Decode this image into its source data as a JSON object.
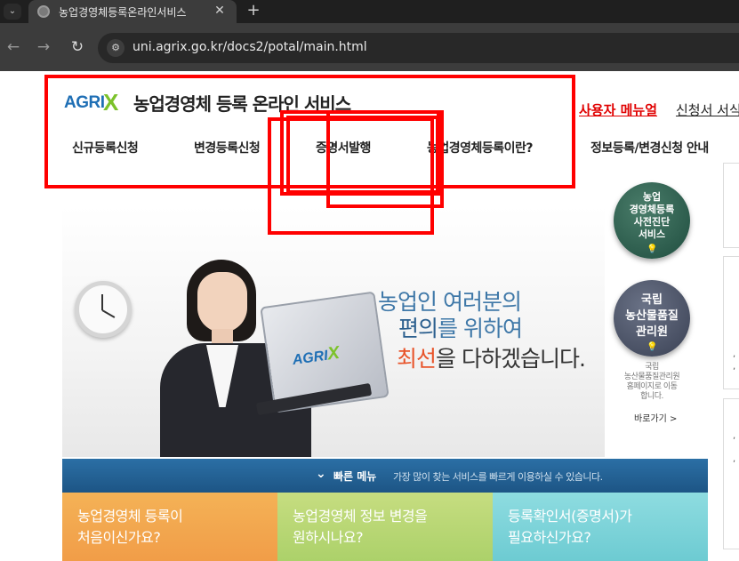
{
  "browser": {
    "tab_title": "농업경영체등록온라인서비스",
    "tab_close": "✕",
    "new_tab": "+",
    "tab_menu": "⌄",
    "back": "←",
    "forward": "→",
    "reload": "↻",
    "site_info": "⚙",
    "url": "uni.agrix.go.kr/docs2/potal/main.html"
  },
  "header": {
    "logo_text": "AGRI",
    "logo_x": "X",
    "title": "농업경영체 등록 온라인 서비스",
    "manual_link": "사용자 메뉴얼",
    "form_link": "신청서 서식"
  },
  "gnb": {
    "items": [
      "신규등록신청",
      "변경등록신청",
      "증명서발행",
      "농업경영체등록이란?",
      "정보등록/변경신청 안내"
    ]
  },
  "hero": {
    "laptop_logo": "AGRI",
    "laptop_logo_x": "X",
    "line1": "농업인 여러분의",
    "line2_em": "편의",
    "line2_rest": "를 위하여",
    "line3_em": "최선",
    "line3_rest": "을 다하겠습니다."
  },
  "quick_menu": {
    "chevron": "✓",
    "title": "빠른 메뉴",
    "description": "가장 많이 찾는 서비스를 빠르게 이용하실 수 있습니다.",
    "cards": [
      {
        "line1": "농업경영체 등록이",
        "line2": "처음이신가요?"
      },
      {
        "line1": "농업경영체 정보 변경을",
        "line2": "원하시나요?"
      },
      {
        "line1": "등록확인서(증명서)가",
        "line2": "필요하신가요?"
      }
    ]
  },
  "side": {
    "badge1": [
      "농업",
      "경영체등록",
      "사전진단",
      "서비스"
    ],
    "badge2": [
      "국립",
      "농산물품질",
      "관리원"
    ],
    "bulb": "💡",
    "note": [
      "국립",
      "농산물품질관리원",
      "홈페이지로 이동",
      "합니다."
    ],
    "link": "바로가기 >"
  },
  "colors": {
    "annotation": "#ff0000",
    "brand_blue": "#1f6fb5",
    "brand_green": "#7cc22b",
    "card_orange": "#f19d48",
    "card_green": "#acd16a",
    "card_teal": "#6dcbd2"
  }
}
